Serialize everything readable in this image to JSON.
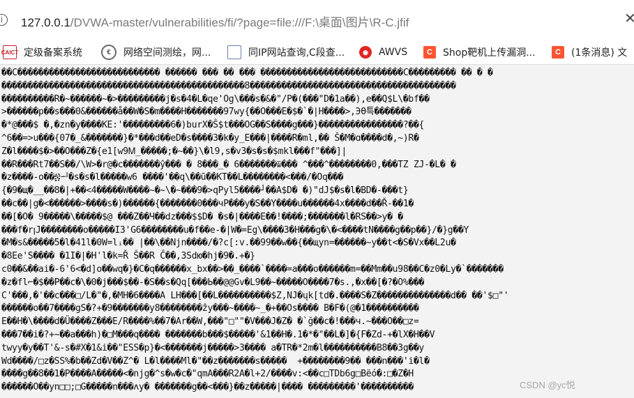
{
  "address_bar": {
    "url_host": "127.0.0.1",
    "url_rest": "/DVWA-master/vulnerabilities/fi/?page=file:///F:\\桌面\\图片\\R-C.jfif",
    "info_icon": "i",
    "close_icon": "✕"
  },
  "bookmarks": [
    {
      "label": "定级备案系统",
      "icon": "caict-logo-icon",
      "icon_text": "CAICT"
    },
    {
      "label": "网络空间测绘，网...",
      "icon": "globe-icon",
      "icon_text": "€"
    },
    {
      "label": "同IP网站查询,C段查...",
      "icon": "page-icon",
      "icon_text": ""
    },
    {
      "label": "AWVS",
      "icon": "awvs-icon",
      "icon_text": "◉"
    },
    {
      "label": "Shop靶机上传漏洞...",
      "icon": "csdn-icon",
      "icon_text": "C"
    },
    {
      "label": "(1条消息) 文",
      "icon": "csdn-icon",
      "icon_text": "C"
    }
  ],
  "colors": {
    "content_background": "#f3f3f3",
    "csdn_orange": "#fc5531",
    "awvs_red": "#e02424"
  },
  "content": {
    "lines": [
      "��C��������������������������� ������ ��� �� ��� ���������������������������C��������� �� � �",
      "����������������������������������������������8���������������������������������������",
      "����������R�~������~�>���������j�s�4�L�qe'Og\\���s�&�\"/P�(���\"D�1a��),e��Q$L\\�bf��",
      ">������p��s���0&������å��W�S�m����H�������97wy{��O���E�$�`�|H����>,ЭӨ특�������",
      "�*@���$ �,�zn�y����KE:'���������6�)burX�Ŝ$t���OG��S����g���}����������������?��{",
      "^6��=>u���{07�_&�������}�*���d��eD�s����3�k�y_E���|����R�ml,�� Š�M�ɑ����d�,~)R�",
      "Z�l����$�>��O���Z�{e1[w9Ꮇ_�����;�~��}\\�l9,s�v3�s�s�$mkl���f\"���]|",
      "��R���Rt7��S��/\\W>�r@�c�������ŷ��� � 8���_� 6�������ѿ��� ^���^��������0,���TZ ZJ-�L� �",
      "�z����-o��፷ᅬ�s�s�l�����w6 ����'��q\\��ṻ��KT��L��������<���/�Oq���",
      "{�9�щ�__��8�|+��<4�����W����~�~\\�~���9�>qPуl5����┘��A$D� �)\"dJ$�s�l�BD�-���t}",
      "��c��|g�<������>����s�)������{�������0���чP���y�S��Y����u������4x����d��Ř-��1�",
      "��[�O� 9�����\\�����$@ ���Z��Ч��dz���$$D� �s�|����E��!����;�������l�RS��>y� �",
      "���f�rꞁJ��������o�����I3'G6��������u�f��e-�|W�=Eg\\����3�H���g�\\�<����tN����g��p��}/�}g��Y",
      "�M�s&�����5�l�41l�0W=lᵢ�� |��\\��Njn����/�?c[:v.��99��w��{��щyn=������~y��t<�S�Vх��L2u�",
      "�8Ee'S���� �1I�|�H'l�k=Ř Š��R Ĉ��,3Sdю�hj�9�.+�}",
      "c0��&��ai�-6'6<�d]o��wq�}�C�q������x_bx��>��_����`����=a���o������m=��Mm��u98��C�z0�Ly�`�������",
      "�z�fl⌐�$��P��c�\\�0�j���$��-�S��s�Qq[���Ь��@@Gv�L9��~�����O����7�s.,�x��[�?�O%���",
      "C'���,�'��c���□/L�\"�,�MH�6����A LH���[��L����������$Z,NJ�ųk[td�.����S�Z��������������d�� ��'$□\"'",
      "������o��7����gS�?+�9�������y8��������ẑy���~����~_�+��Os���� B�F�(@�1����������",
      "E��H�\\����d�Ü����Z���E/R����%��7�Ar��W,���\"□\"\"�V���J�Z� �`ğ��c�!���ч.~���O��□z=",
      "���7��i�?+~��a���h)�□M���q���� �������b���$�����'&1��H�.1�*�\"��L�]�{F�Zd-+�lX�H��V",
      "twyy�y��T'&-s�#X�1&i��\"ESS�p}�<�������j�����>3���� a�TR�*2m�l����������B8��3g��y",
      "Wd����/□z�SS%�b��Zd�V��Z^� L�l����Ml�\"��z�������s�����  +��������9�� ���n���'i�l�",
      "����g��8��1�P����A�����<�njg�^s�w�c�\"qmA���R2A�l+2/����v:<��c□TDb6g□Bëó�:□�Z�H",
      "������O��yn□□;□G�����n���ʌy� �������g��<���}��z�����|���� ���������'����������"
    ]
  },
  "watermark": "CSDN @yc悦"
}
